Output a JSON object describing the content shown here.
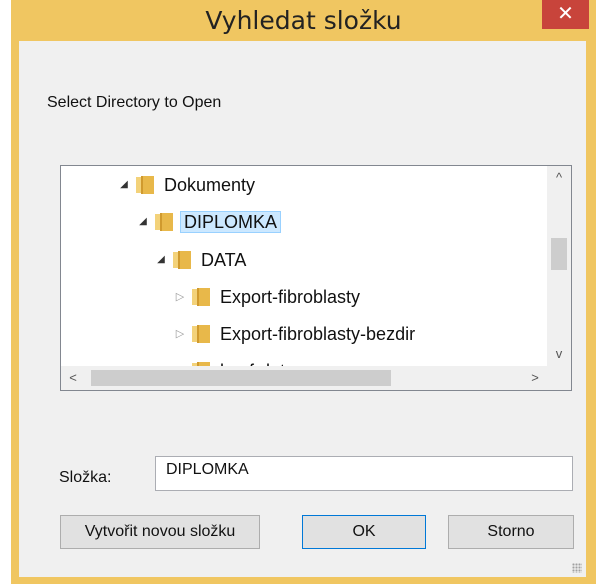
{
  "dialog": {
    "title": "Vyhledat složku",
    "close_glyph": "✕",
    "prompt": "Select Directory to Open"
  },
  "tree": {
    "items": [
      {
        "label": "Dokumenty",
        "expander": "◢",
        "level": 0
      },
      {
        "label": "DIPLOMKA",
        "expander": "◢",
        "level": 1,
        "selected": true
      },
      {
        "label": "DATA",
        "expander": "◢",
        "level": 2
      },
      {
        "label": "Export-fibroblasty",
        "expander": "▷",
        "level": 3
      },
      {
        "label": "Export-fibroblasty-bezdir",
        "expander": "▷",
        "level": 3
      },
      {
        "label": "konf-data",
        "expander": "▷",
        "level": 3
      }
    ],
    "scroll_up_glyph": "^",
    "scroll_down_glyph": "v",
    "scroll_left_glyph": "<",
    "scroll_right_glyph": ">"
  },
  "folder_field": {
    "label": "Složka:",
    "value": "DIPLOMKA"
  },
  "buttons": {
    "new_folder": "Vytvořit novou složku",
    "ok": "OK",
    "cancel": "Storno"
  },
  "colors": {
    "window_frame": "#f0c661",
    "close_button": "#c8443b",
    "selection": "#cce8ff",
    "folder": "#e8b84a"
  }
}
